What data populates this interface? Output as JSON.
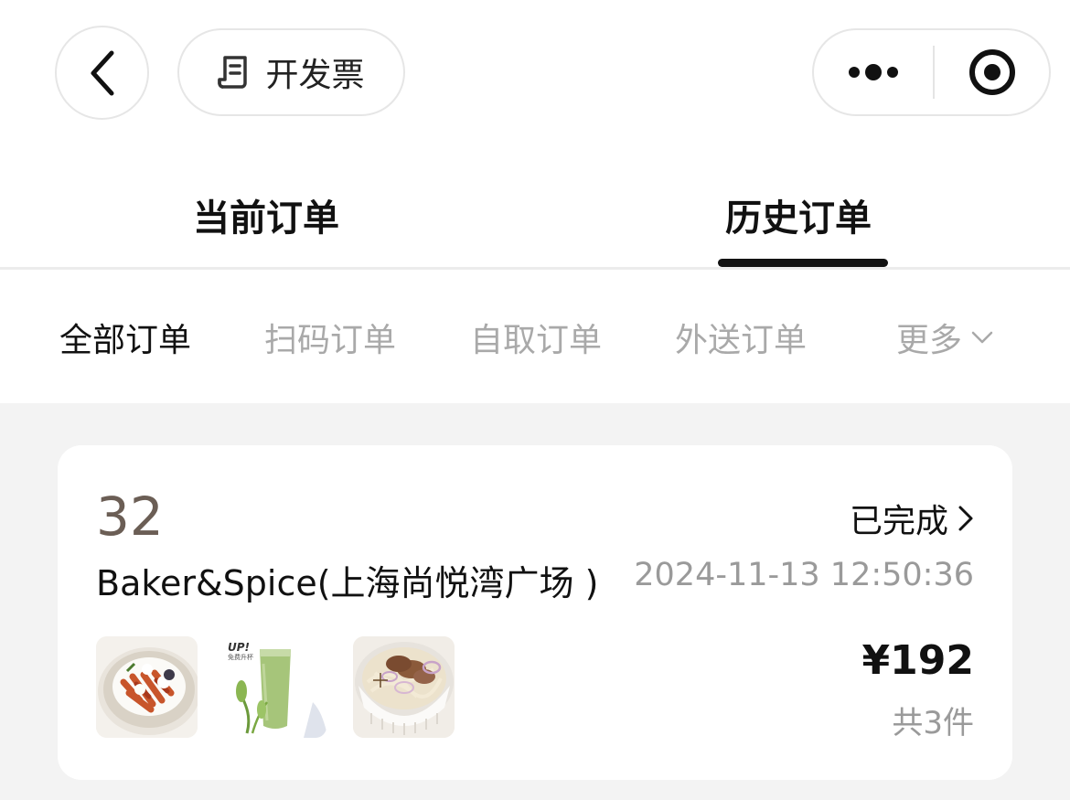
{
  "header": {
    "invoice_label": "开发票",
    "icons": {
      "back": "chevron-left-icon",
      "invoice": "receipt-icon",
      "more": "more-dots-icon",
      "close": "target-close-icon"
    }
  },
  "tabs": [
    {
      "label": "当前订单",
      "active": false
    },
    {
      "label": "历史订单",
      "active": true
    }
  ],
  "filters": [
    {
      "label": "全部订单",
      "active": true
    },
    {
      "label": "扫码订单",
      "active": false
    },
    {
      "label": "自取订单",
      "active": false
    },
    {
      "label": "外送订单",
      "active": false
    },
    {
      "label": "更多",
      "active": false,
      "icon": "chevron-down-icon"
    }
  ],
  "order": {
    "number": "32",
    "status": "已完成",
    "store": "Baker&Spice(上海尚悦湾广场 )",
    "time": "2024-11-13 12:50:36",
    "price": "¥192",
    "count": "共3件",
    "thumb_badge": "UP!",
    "thumb_badge_sub": "免费升杯",
    "items": [
      "pasta-dish",
      "green-smoothie",
      "beef-noodle-soup"
    ]
  },
  "colors": {
    "order_number": "#6b5e55",
    "muted": "#9a9a9a",
    "gray_background": "#f3f3f3",
    "active_text": "#111111"
  }
}
